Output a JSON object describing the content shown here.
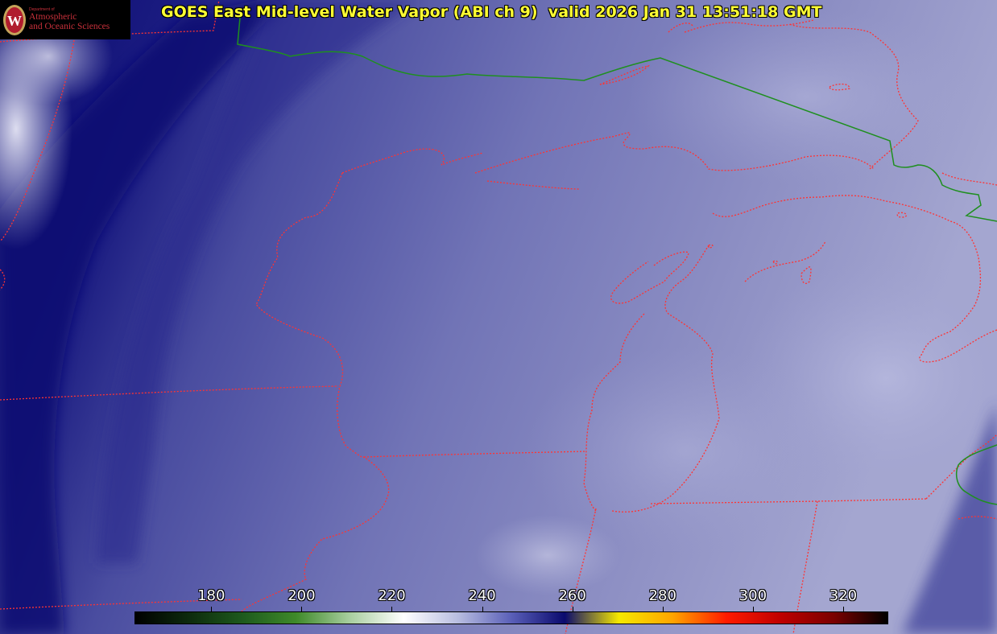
{
  "header": {
    "title": "GOES East Mid-level Water Vapor (ABI ch 9)  valid 2026 Jan 31 13:51:18 GMT"
  },
  "logo": {
    "small_text": "Department of",
    "line1": "Atmospheric",
    "line2": "and Oceanic Sciences",
    "seal_letter": "W"
  },
  "colorbar": {
    "ticks": [
      "180",
      "200",
      "220",
      "240",
      "260",
      "280",
      "300",
      "320"
    ],
    "range": [
      163,
      330
    ],
    "colors": [
      "#000000",
      "#0d2a0d",
      "#1e5a1e",
      "#3f8a2a",
      "#a9cfa0",
      "#ffffff",
      "#b8bde0",
      "#5a5fb8",
      "#0a0a6e",
      "#f6e800",
      "#ffa500",
      "#ff1a00",
      "#c00000",
      "#7a0000",
      "#000000"
    ]
  },
  "map_colors": {
    "state_borders": "#ff3030",
    "international_border": "#1a8a1a",
    "vapor_dark": "#0b0b6e",
    "vapor_mid": "#6f72b4",
    "vapor_light": "#c9cae6"
  }
}
